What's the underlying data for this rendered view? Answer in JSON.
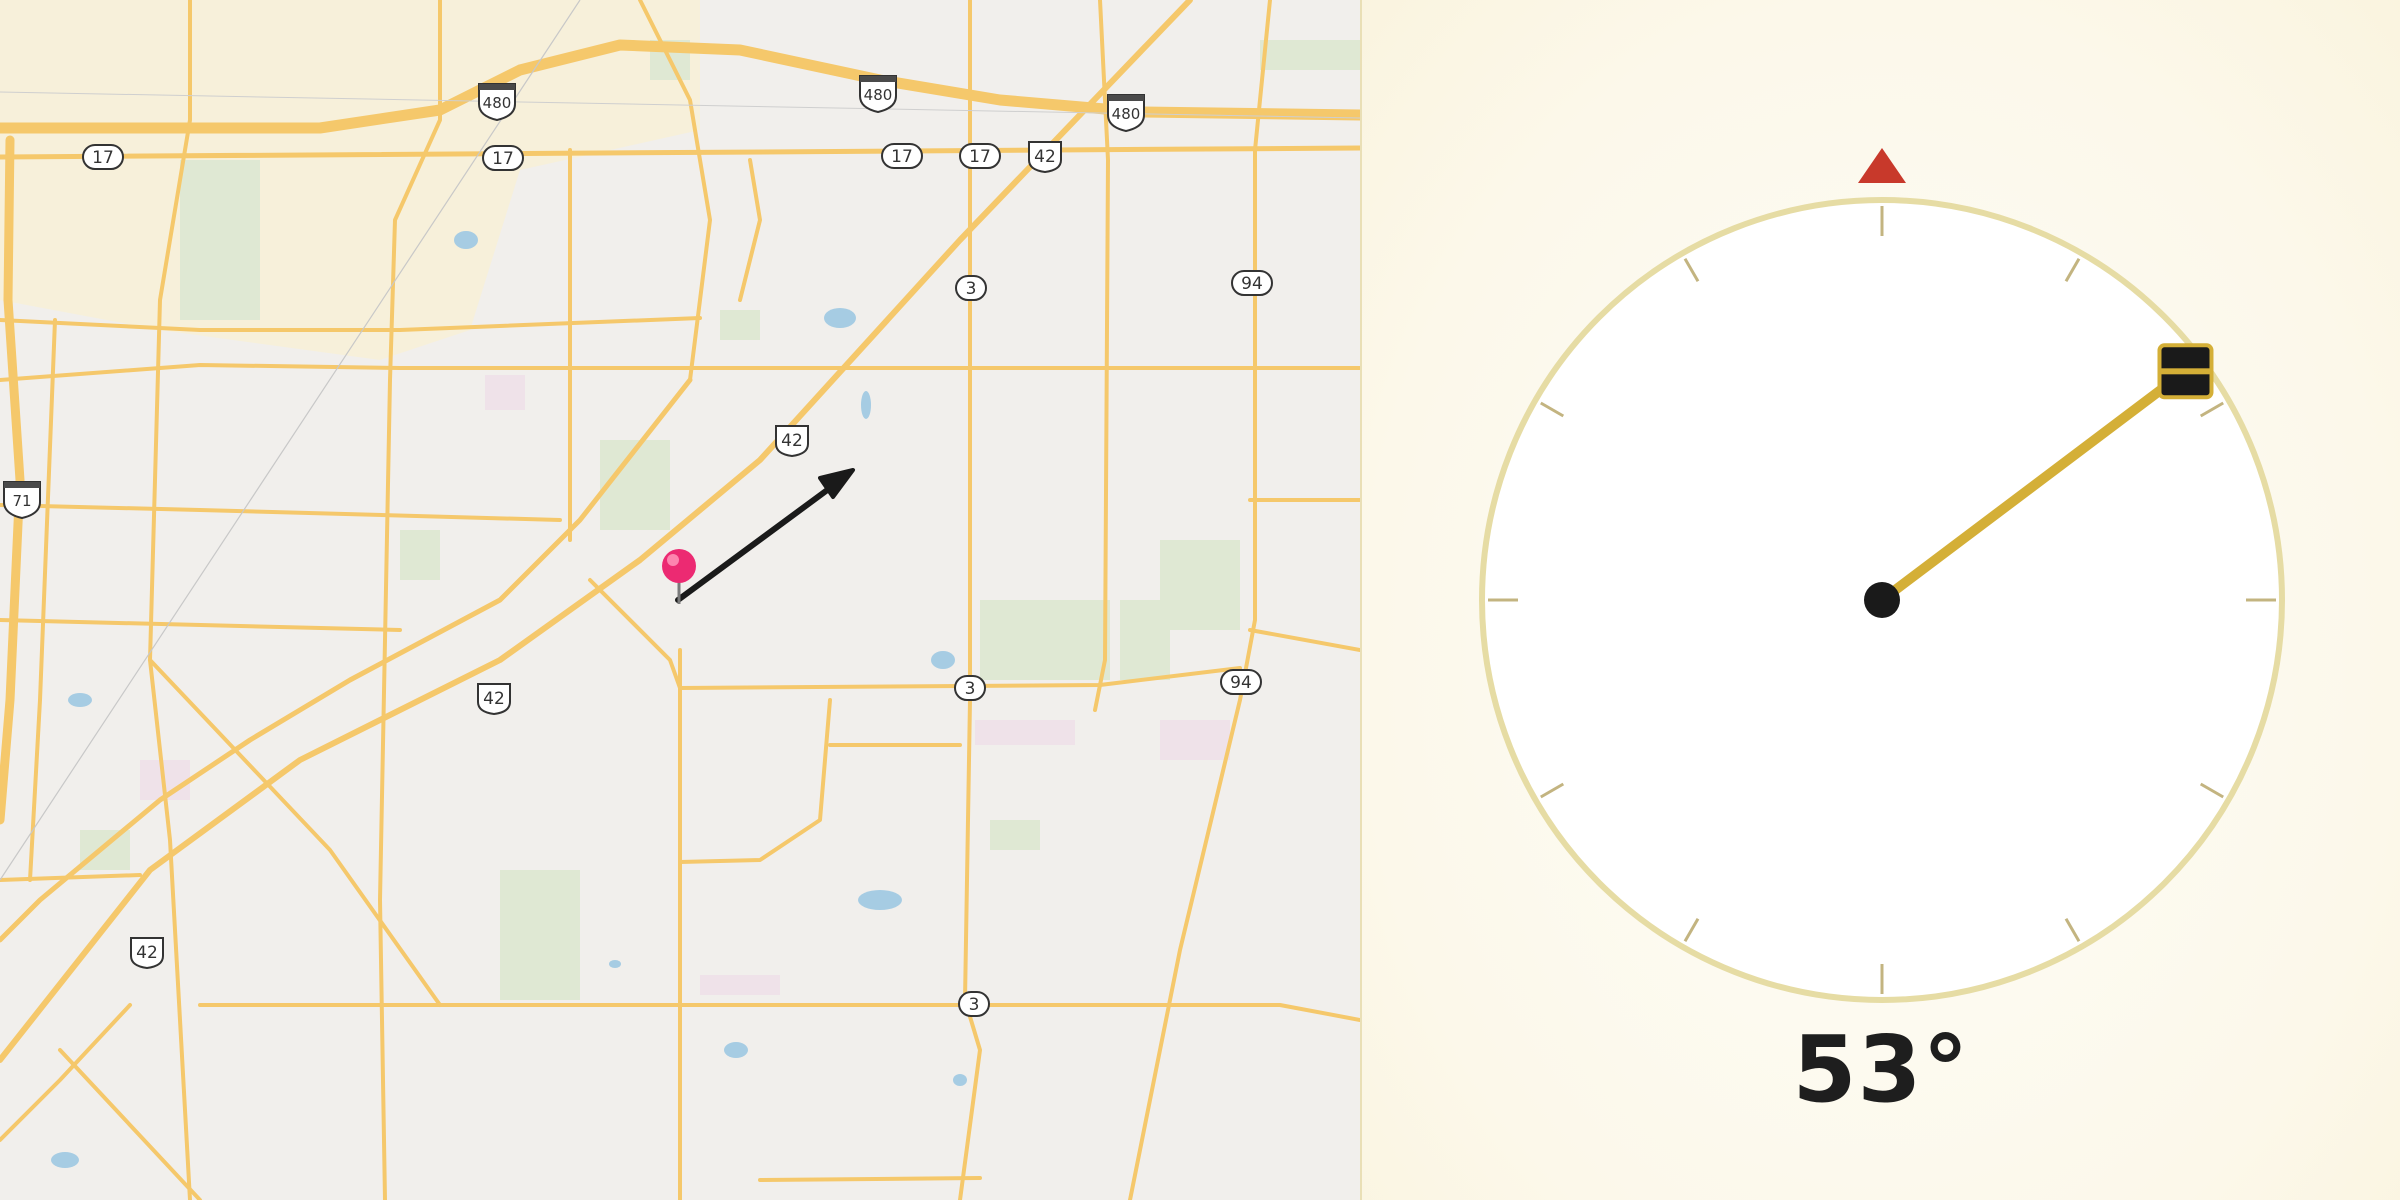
{
  "map": {
    "route_labels": [
      {
        "type": "interstate",
        "number": "480"
      },
      {
        "type": "interstate",
        "number": "480"
      },
      {
        "type": "interstate",
        "number": "480"
      },
      {
        "type": "interstate",
        "number": "71"
      },
      {
        "type": "state",
        "number": "17"
      },
      {
        "type": "state",
        "number": "17"
      },
      {
        "type": "state",
        "number": "17"
      },
      {
        "type": "state",
        "number": "17"
      },
      {
        "type": "us",
        "number": "42"
      },
      {
        "type": "us",
        "number": "42"
      },
      {
        "type": "us",
        "number": "42"
      },
      {
        "type": "us",
        "number": "42"
      },
      {
        "type": "state",
        "number": "3"
      },
      {
        "type": "state",
        "number": "3"
      },
      {
        "type": "state",
        "number": "3"
      },
      {
        "type": "state",
        "number": "94"
      },
      {
        "type": "state",
        "number": "94"
      }
    ],
    "pin_icon": "map-pin-icon",
    "direction_arrow_icon": "direction-arrow-icon"
  },
  "compass": {
    "heading_value": 53,
    "heading_label": "53°",
    "north_marker_icon": "north-triangle-icon",
    "colors": {
      "north_marker": "#c8392b",
      "needle": "#d4af37",
      "ring": "#e6dca4",
      "tick": "#c3b480",
      "hub": "#1a1a1a"
    }
  }
}
